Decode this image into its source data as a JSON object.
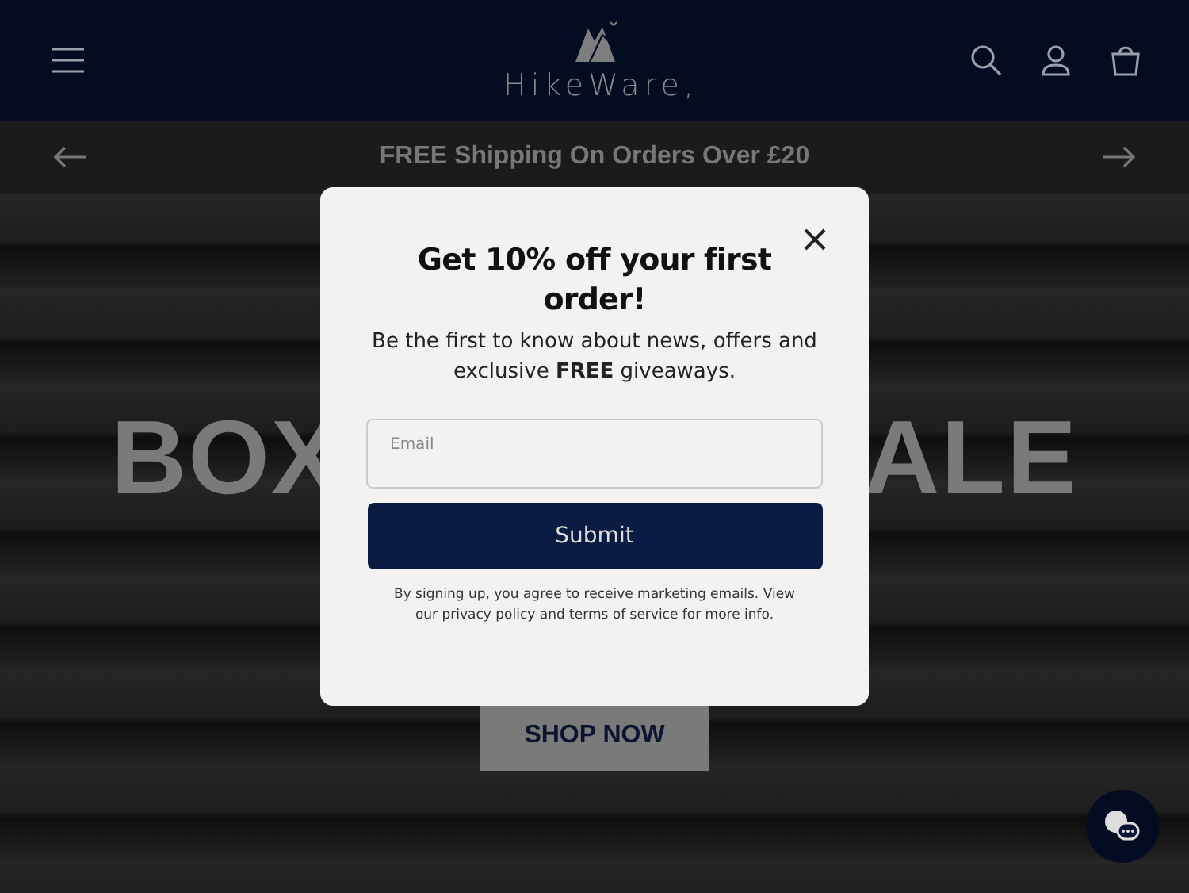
{
  "header": {
    "brand": "HikeWare,"
  },
  "announcement": {
    "text": "FREE Shipping On Orders Over £20"
  },
  "hero": {
    "title_parts": [
      "BOX",
      "ALE"
    ],
    "button": "SHOP NOW"
  },
  "popup": {
    "title": "Get 10% off your first order!",
    "text": "Be the first to know about news, offers and exclusive **FREE** giveaways.",
    "email": {
      "placeholder": "Email"
    },
    "button": "Submit",
    "disclaimer": "By signing up, you agree to receive marketing emails. View our privacy policy and terms of service for more info."
  }
}
